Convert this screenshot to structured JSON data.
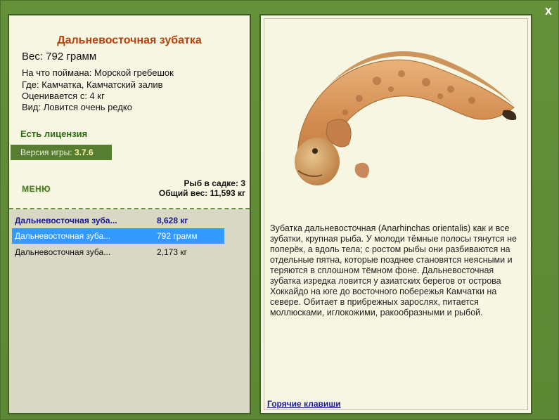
{
  "close": {
    "label": "x"
  },
  "fish": {
    "title": "Дальневосточная зубатка",
    "weight": "Вес: 792 грамм",
    "caught_on": "На что поймана: Морской гребешок",
    "location": "Где: Камчатка, Камчатский залив",
    "rated_from": "Оценивается с: 4 кг",
    "rarity": "Вид: Ловится очень редко"
  },
  "license": "Есть лицензия",
  "version": {
    "label": "Версия игры: ",
    "value": "3.7.6"
  },
  "menu_label": "МЕНЮ",
  "keepnet": {
    "count": "Рыб в садке: 3",
    "total": "Общий вес: 11,593 кг"
  },
  "catch_list": [
    {
      "name": "Дальневосточная зуба...",
      "weight": "8,628 кг",
      "style": "bold"
    },
    {
      "name": "Дальневосточная зуба...",
      "weight": "792 грамм",
      "style": "selected"
    },
    {
      "name": "Дальневосточная зуба...",
      "weight": "2,173 кг",
      "style": "plain"
    }
  ],
  "description": "Зубатка дальневосточная (Anarhinchas orientalis) как и все зубатки, крупная рыба. У молоди тёмные полосы тянутся не поперёк, а вдоль тела; с ростом рыбы они разбиваются на отдельные пятна, которые позднее становятся неясными и теряются в сплошном тёмном фоне. Дальневосточная зубатка изредка ловится у азиатских берегов от острова Хоккайдо на юге до восточного побережья Камчатки на севере. Обитает в прибрежных зарослях, питается моллюсками, иглокожими, ракообразными и рыбой.",
  "hotkeys_label": "Горячие клавиши",
  "colors": {
    "background": "#5f8a36",
    "panel": "#f6f6e2",
    "title": "#b5420f",
    "selected_row": "#3399ff"
  },
  "icons": {
    "close": "close-icon",
    "fish": "wolffish-image"
  }
}
